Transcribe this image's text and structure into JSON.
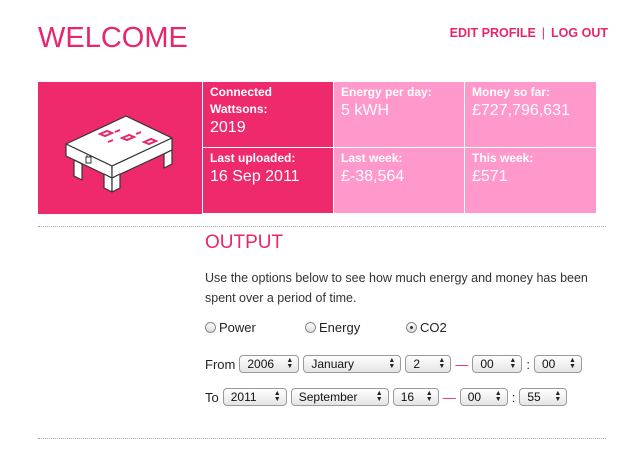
{
  "header": {
    "title": "WELCOME",
    "edit_profile": "EDIT PROFILE",
    "separator": "|",
    "log_out": "LOG OUT"
  },
  "stats": {
    "connected_label": "Connected Wattsons:",
    "connected_value": "2019",
    "uploaded_label": "Last uploaded:",
    "uploaded_value": "16 Sep 2011",
    "energy_day_label": "Energy per day:",
    "energy_day_value": "5 kWH",
    "last_week_label": "Last week:",
    "last_week_value": "£-38,564",
    "money_label": "Money so far:",
    "money_value": "£727,796,631",
    "this_week_label": "This week:",
    "this_week_value": "£571"
  },
  "output": {
    "heading": "OUTPUT",
    "description": "Use the options below to see how much energy and money has been spent over a period of time.",
    "radios": [
      {
        "label": "Power",
        "checked": false
      },
      {
        "label": "Energy",
        "checked": false
      },
      {
        "label": "CO2",
        "checked": true
      }
    ]
  },
  "from": {
    "label": "From",
    "year": "2006",
    "month": "January",
    "day": "2",
    "hour": "00",
    "minute": "00",
    "dash": "—",
    "colon": ":"
  },
  "to": {
    "label": "To",
    "year": "2011",
    "month": "September",
    "day": "16",
    "hour": "00",
    "minute": "55",
    "dash": "—",
    "colon": ":"
  },
  "colors": {
    "accent": "#e8256d",
    "tile_dark": "#ee2a6d",
    "tile_light": "#ff99cc"
  }
}
